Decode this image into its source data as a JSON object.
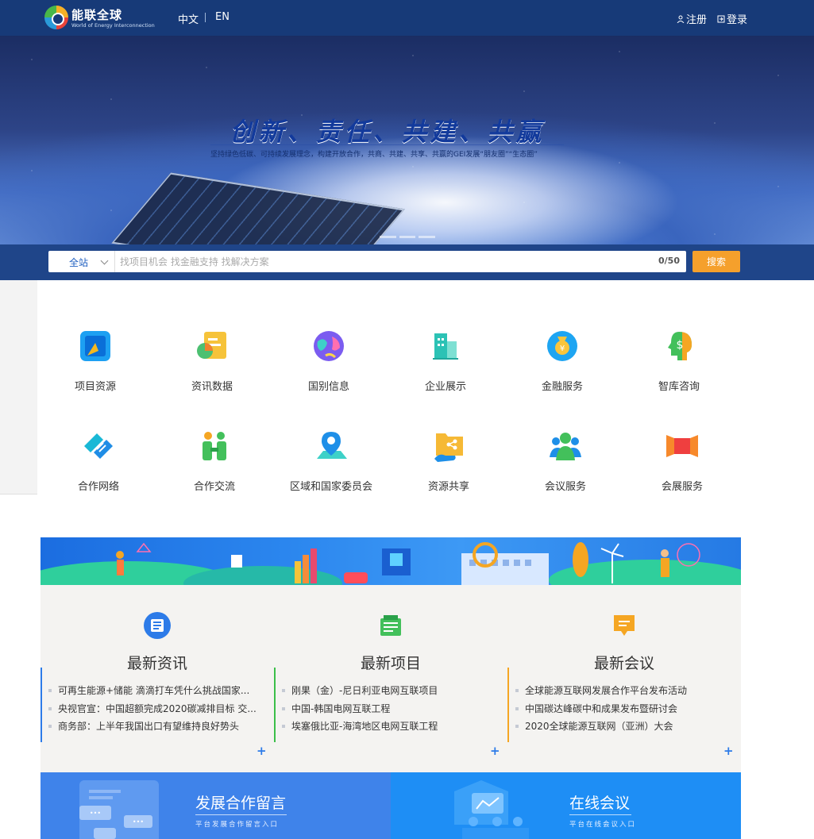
{
  "header": {
    "logo_cn": "能联全球",
    "logo_en": "World of Energy Interconnection",
    "lang_cn": "中文",
    "lang_en": "EN",
    "register": "注册",
    "login": "登录"
  },
  "hero": {
    "title": "创新、责任、共建、共赢",
    "subtitle": "坚持绿色低碳、可持续发展理念，构建开放合作，共商、共建、共享、共赢的GEI发展“朋友圈”“生态圈”"
  },
  "search": {
    "scope": "全站",
    "placeholder": "找项目机会 找金融支持 找解决方案",
    "counter": "0/50",
    "button": "搜索"
  },
  "services": [
    {
      "label": "项目资源",
      "icon": "project-icon"
    },
    {
      "label": "资讯数据",
      "icon": "data-icon"
    },
    {
      "label": "国别信息",
      "icon": "globe-icon"
    },
    {
      "label": "企业展示",
      "icon": "building-icon"
    },
    {
      "label": "金融服务",
      "icon": "finance-icon"
    },
    {
      "label": "智库咨询",
      "icon": "think-tank-icon"
    },
    {
      "label": "合作网络",
      "icon": "handshake-icon"
    },
    {
      "label": "合作交流",
      "icon": "people-exchange-icon"
    },
    {
      "label": "区域和国家委员会",
      "icon": "location-pin-icon"
    },
    {
      "label": "资源共享",
      "icon": "share-folder-icon"
    },
    {
      "label": "会议服务",
      "icon": "meeting-icon"
    },
    {
      "label": "会展服务",
      "icon": "exhibition-icon"
    }
  ],
  "columns": [
    {
      "title": "最新资讯",
      "color": "#2d7be8",
      "items": [
        "可再生能源+储能 滴滴打车凭什么挑战国家...",
        "央视官宣：中国超额完成2020碳减排目标 交...",
        "商务部：上半年我国出口有望维持良好势头"
      ]
    },
    {
      "title": "最新项目",
      "color": "#3bbf4a",
      "items": [
        "刚果（金）-尼日利亚电网互联项目",
        "中国-韩国电网互联工程",
        "埃塞俄比亚-海湾地区电网互联工程"
      ]
    },
    {
      "title": "最新会议",
      "color": "#f5a623",
      "items": [
        "全球能源互联网发展合作平台发布活动",
        "中国碳达峰碳中和成果发布暨研讨会",
        "2020全球能源互联网（亚洲）大会"
      ]
    }
  ],
  "cards": [
    {
      "title": "发展合作留言",
      "subtitle": "平台发展合作留言入口",
      "color": "#3f83ea"
    },
    {
      "title": "在线会议",
      "subtitle": "平台在线会议入口",
      "color": "#1e8ef5"
    }
  ],
  "more_label": "+"
}
